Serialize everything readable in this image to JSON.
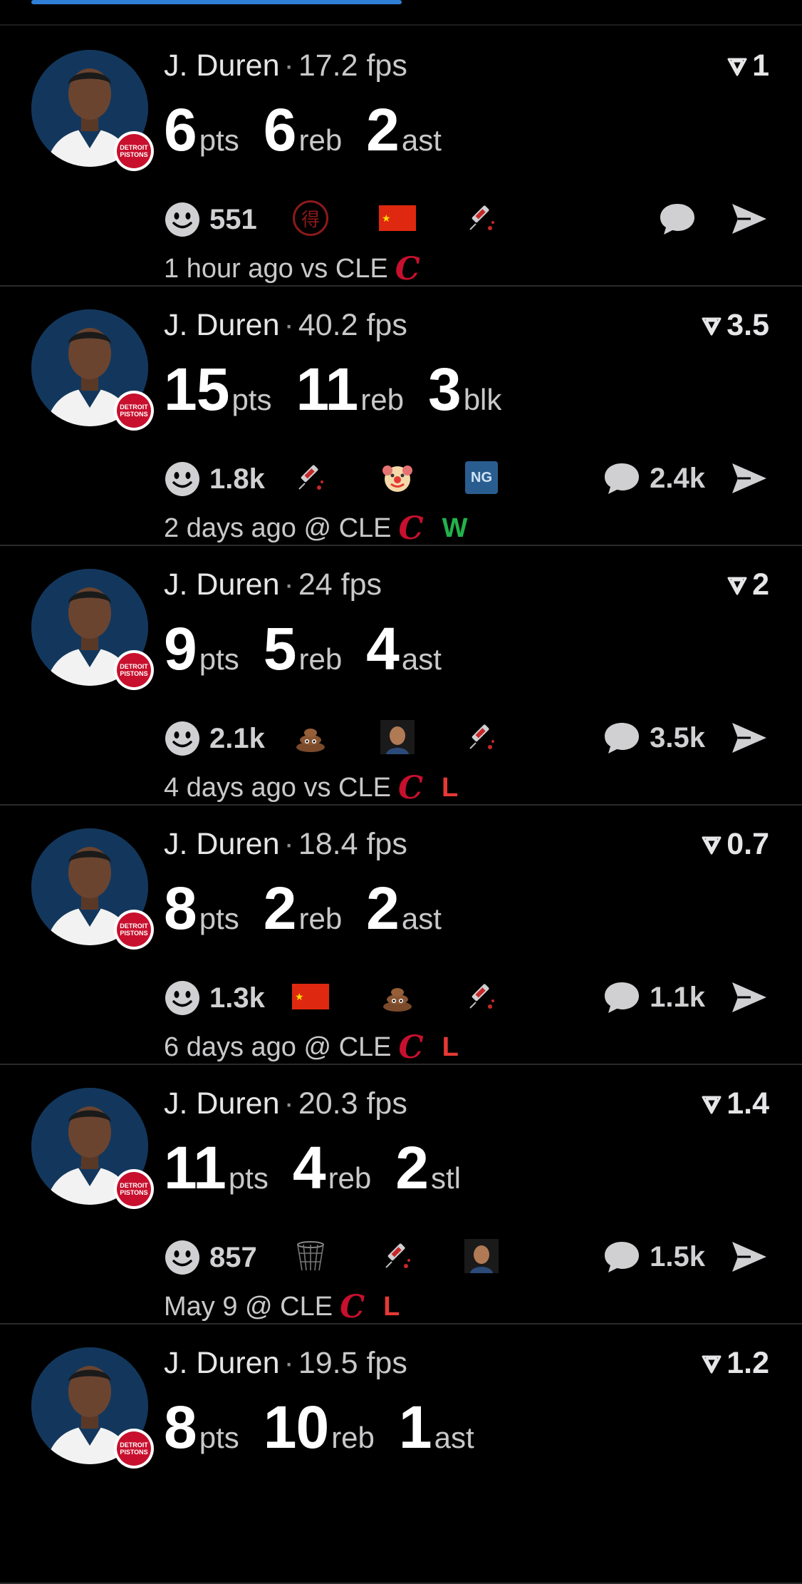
{
  "colors": {
    "background": "#000000",
    "accent": "#2f7fd6",
    "win": "#22b24c",
    "loss": "#e53935",
    "team": "#c8102e"
  },
  "badge": {
    "line1": "DETROIT",
    "line2": "PISTONS"
  },
  "posts": [
    {
      "name": "J. Duren",
      "fps": "17.2 fps",
      "rank": "1",
      "stats": [
        {
          "num": "6",
          "lbl": "pts"
        },
        {
          "num": "6",
          "lbl": "reb"
        },
        {
          "num": "2",
          "lbl": "ast"
        }
      ],
      "reactions": "551",
      "emojis": [
        "stamp-icon",
        "china-flag-icon",
        "syringe-icon"
      ],
      "comments": "",
      "time": "1 hour ago vs CLE",
      "opponent_logo": "C",
      "result": ""
    },
    {
      "name": "J. Duren",
      "fps": "40.2 fps",
      "rank": "3.5",
      "stats": [
        {
          "num": "15",
          "lbl": "pts"
        },
        {
          "num": "11",
          "lbl": "reb"
        },
        {
          "num": "3",
          "lbl": "blk"
        }
      ],
      "reactions": "1.8k",
      "emojis": [
        "syringe-icon",
        "clown-icon",
        "ng-icon"
      ],
      "comments": "2.4k",
      "time": "2 days ago @ CLE",
      "opponent_logo": "C",
      "result": "W"
    },
    {
      "name": "J. Duren",
      "fps": "24 fps",
      "rank": "2",
      "stats": [
        {
          "num": "9",
          "lbl": "pts"
        },
        {
          "num": "5",
          "lbl": "reb"
        },
        {
          "num": "4",
          "lbl": "ast"
        }
      ],
      "reactions": "2.1k",
      "emojis": [
        "poop-icon",
        "player-face-icon",
        "syringe-icon"
      ],
      "comments": "3.5k",
      "time": "4 days ago vs CLE",
      "opponent_logo": "C",
      "result": "L"
    },
    {
      "name": "J. Duren",
      "fps": "18.4 fps",
      "rank": "0.7",
      "stats": [
        {
          "num": "8",
          "lbl": "pts"
        },
        {
          "num": "2",
          "lbl": "reb"
        },
        {
          "num": "2",
          "lbl": "ast"
        }
      ],
      "reactions": "1.3k",
      "emojis": [
        "china-flag-icon",
        "poop-icon",
        "syringe-icon"
      ],
      "comments": "1.1k",
      "time": "6 days ago @ CLE",
      "opponent_logo": "C",
      "result": "L"
    },
    {
      "name": "J. Duren",
      "fps": "20.3 fps",
      "rank": "1.4",
      "stats": [
        {
          "num": "11",
          "lbl": "pts"
        },
        {
          "num": "4",
          "lbl": "reb"
        },
        {
          "num": "2",
          "lbl": "stl"
        }
      ],
      "reactions": "857",
      "emojis": [
        "basketball-net-icon",
        "syringe-icon",
        "player-face-icon"
      ],
      "comments": "1.5k",
      "time": "May 9 @ CLE",
      "opponent_logo": "C",
      "result": "L"
    },
    {
      "name": "J. Duren",
      "fps": "19.5 fps",
      "rank": "1.2",
      "stats": [
        {
          "num": "8",
          "lbl": "pts"
        },
        {
          "num": "10",
          "lbl": "reb"
        },
        {
          "num": "1",
          "lbl": "ast"
        }
      ],
      "reactions": "",
      "emojis": [],
      "comments": "",
      "time": "",
      "opponent_logo": "",
      "result": ""
    }
  ]
}
